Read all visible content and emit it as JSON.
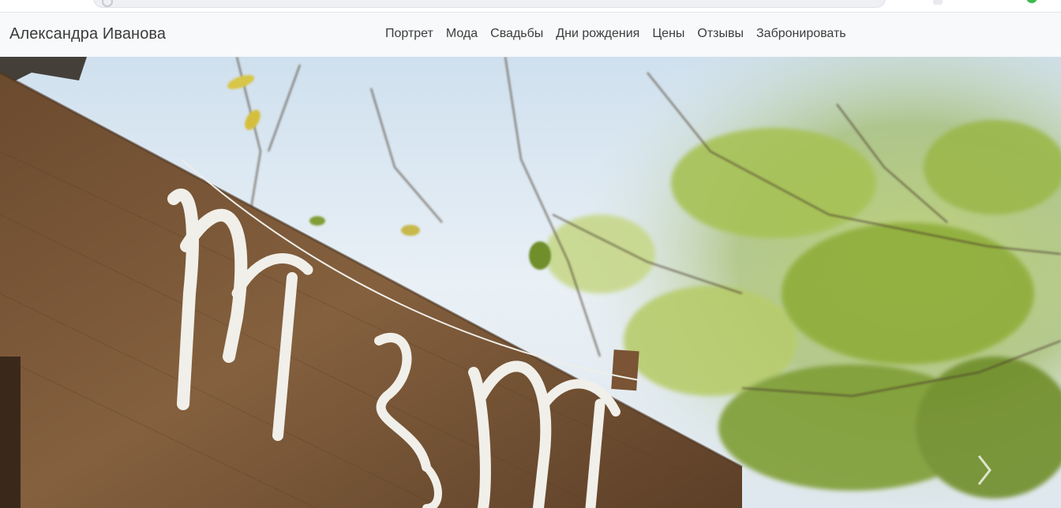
{
  "site": {
    "brand": "Александра Иванова"
  },
  "nav": {
    "items": [
      {
        "label": "Портрет"
      },
      {
        "label": "Мода"
      },
      {
        "label": "Свадьбы"
      },
      {
        "label": "Дни рождения"
      },
      {
        "label": "Цены"
      },
      {
        "label": "Отзывы"
      },
      {
        "label": "Забронировать"
      }
    ]
  },
  "hero": {
    "sign_text": "Mr & Mrs",
    "next_icon": "chevron-right-icon"
  },
  "colors": {
    "header_bg": "#f8f9fa",
    "text": "#3d3d3d",
    "sky": "#dfe9f2",
    "wood": "#7a5434",
    "leaves": "#8fae3a"
  }
}
